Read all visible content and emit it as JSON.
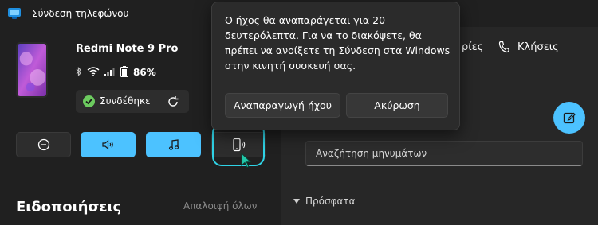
{
  "app": {
    "title": "Σύνδεση τηλεφώνου"
  },
  "device": {
    "name": "Redmi Note 9 Pro",
    "battery": "86%",
    "status": "Συνδέθηκε"
  },
  "actions": [
    {
      "icon": "do-not-disturb-icon"
    },
    {
      "icon": "volume-icon"
    },
    {
      "icon": "music-icon"
    },
    {
      "icon": "ring-phone-icon"
    }
  ],
  "notifications": {
    "title": "Ειδοποιήσεις",
    "clear_all": "Απαλοιφή όλων"
  },
  "tabs": {
    "photos_partial": "ρίες",
    "calls": "Κλήσεις"
  },
  "messages": {
    "search_placeholder": "Αναζήτηση μηνυμάτων",
    "recent": "Πρόσφατα"
  },
  "popup": {
    "message": "Ο ήχος θα αναπαράγεται για 20 δευτερόλεπτα. Για να το διακόψετε, θα πρέπει να ανοίξετε τη Σύνδεση στα Windows στην κινητή συσκευή σας.",
    "play_label": "Αναπαραγωγή ήχου",
    "cancel_label": "Ακύρωση"
  },
  "colors": {
    "accent": "#4cc2ff",
    "highlight_ring": "#2fd3e6",
    "connected_green": "#6ccb5f"
  }
}
